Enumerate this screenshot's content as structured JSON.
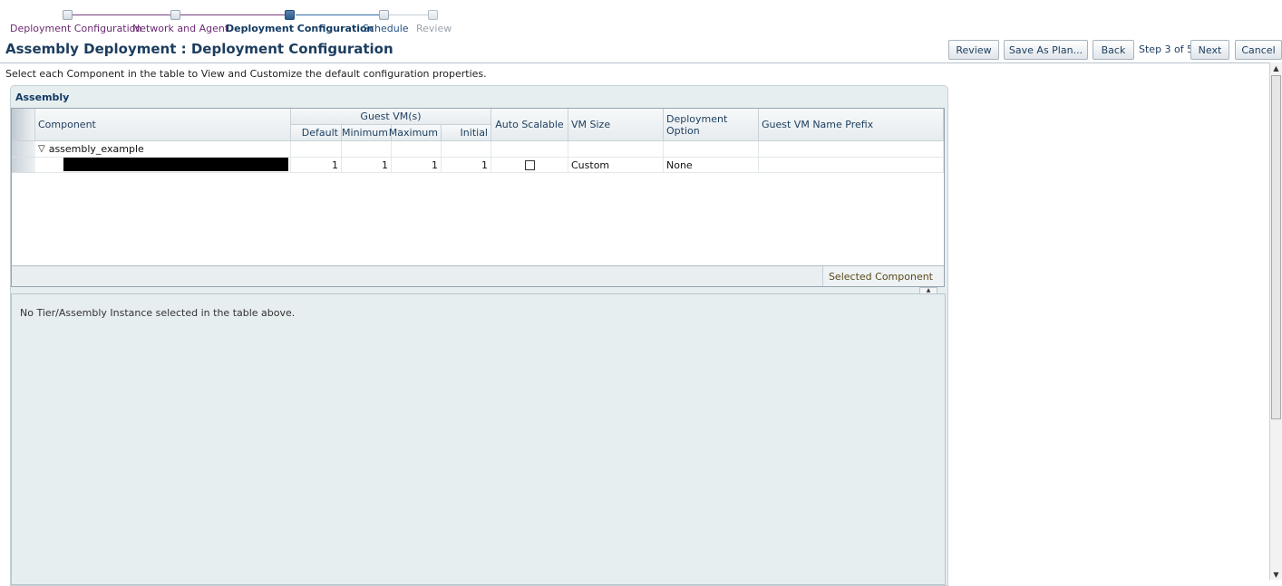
{
  "train": {
    "steps": [
      {
        "label": "Deployment Configuration",
        "state": "visited"
      },
      {
        "label": "Network and Agent",
        "state": "visited"
      },
      {
        "label": "Deployment Configuration",
        "state": "current"
      },
      {
        "label": "Schedule",
        "state": "next"
      },
      {
        "label": "Review",
        "state": "disabled"
      }
    ]
  },
  "page": {
    "title": "Assembly Deployment : Deployment Configuration",
    "instruction": "Select each Component in the table to View and Customize the default configuration properties."
  },
  "toolbar": {
    "review_label": "Review",
    "save_plan_label": "Save As Plan...",
    "back_label": "Back",
    "step_text": "Step 3 of 5",
    "next_label": "Next",
    "cancel_label": "Cancel"
  },
  "assembly": {
    "panel_title": "Assembly",
    "columns": {
      "component": "Component",
      "guest_vms": "Guest VM(s)",
      "default": "Default",
      "minimum": "Minimum",
      "maximum": "Maximum",
      "initial": "Initial",
      "auto_scalable": "Auto Scalable",
      "vm_size": "VM Size",
      "deployment_option": "Deployment Option",
      "guest_vm_name_prefix": "Guest VM Name Prefix"
    },
    "rows": [
      {
        "component": "assembly_example",
        "expanded": true,
        "disclosure": "▽"
      },
      {
        "component": "",
        "redacted": true,
        "default": "1",
        "minimum": "1",
        "maximum": "1",
        "initial": "1",
        "auto_scalable": false,
        "vm_size": "Custom",
        "deployment_option": "None",
        "guest_vm_name_prefix": ""
      }
    ],
    "selected_component_label": "Selected Component"
  },
  "detail": {
    "message": "No Tier/Assembly Instance selected in the table above."
  },
  "colors": {
    "title": "#1c3d5e",
    "train_visited": "#6b2a74",
    "train_current": "#2c5a8c",
    "panel_bg": "#e7eef0"
  }
}
